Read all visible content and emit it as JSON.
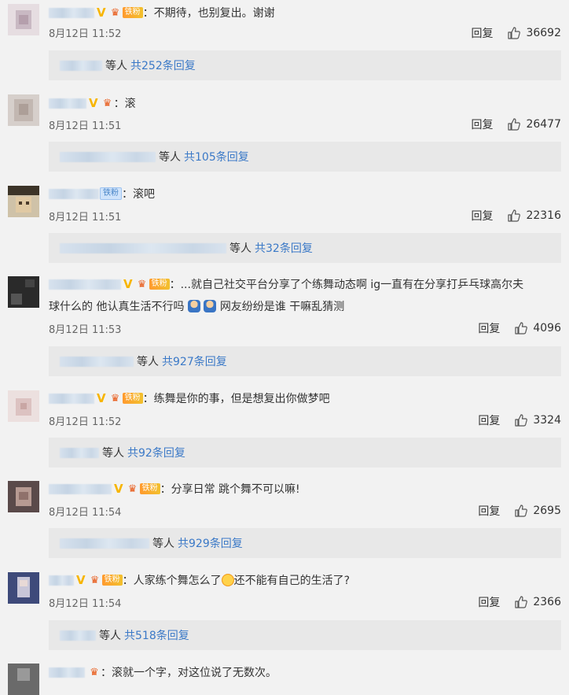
{
  "labels": {
    "reply": "回复",
    "others": "等人"
  },
  "comments": [
    {
      "text": "：不期待，也别复出。谢谢",
      "fan_badge": "铁粉",
      "date": "8月12日 11:52",
      "likes": "36692",
      "replies_link": "共252条回复"
    },
    {
      "text": "：滚",
      "fan_badge": "",
      "date": "8月12日 11:51",
      "likes": "26477",
      "replies_link": "共105条回复"
    },
    {
      "text": "：滚吧",
      "fan_badge": "铁粉",
      "date": "8月12日 11:51",
      "likes": "22316",
      "replies_link": "共32条回复"
    },
    {
      "text": "：...就自己社交平台分享了个练舞动态啊  ig一直有在分享打乒乓球高尔夫",
      "text_line2_a": "球什么的 他认真生活不行吗",
      "text_line2_b": " 网友纷纷是谁 干嘛乱猜测",
      "fan_badge": "铁粉",
      "date": "8月12日 11:53",
      "likes": "4096",
      "replies_link": "共927条回复"
    },
    {
      "text": "：练舞是你的事，但是想复出你做梦吧",
      "fan_badge": "铁粉",
      "date": "8月12日 11:52",
      "likes": "3324",
      "replies_link": "共92条回复"
    },
    {
      "text": "：分享日常 跳个舞不可以嘛!",
      "fan_badge": "铁粉",
      "date": "8月12日 11:54",
      "likes": "2695",
      "replies_link": "共929条回复"
    },
    {
      "text_a": "：人家练个舞怎么了",
      "text_b": "还不能有自己的生活了?",
      "fan_badge": "铁粉",
      "date": "8月12日 11:54",
      "likes": "2366",
      "replies_link": "共518条回复"
    },
    {
      "text": "：滚就一个字，对这位说了无数次。"
    }
  ],
  "icons": {
    "like": "thumbs-up-icon",
    "verified": "verified-v-icon",
    "crown": "crown-icon"
  }
}
